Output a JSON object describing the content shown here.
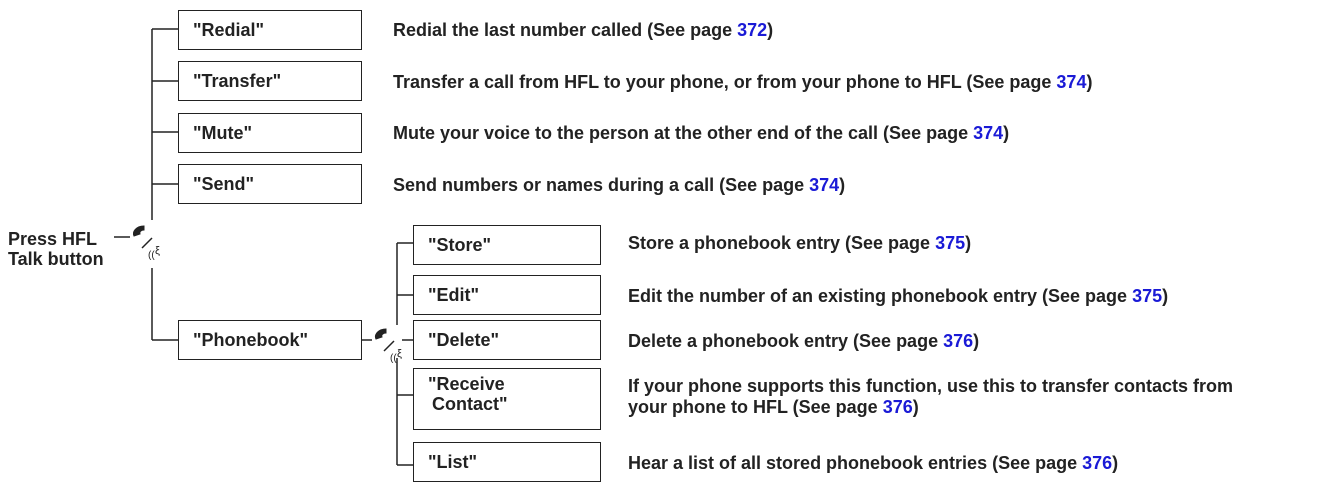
{
  "root": {
    "line1": "Press HFL",
    "line2": "Talk button"
  },
  "top_items": [
    {
      "label": "\"Redial\"",
      "desc": "Redial the last number called (See page ",
      "page": "372",
      "desc_end": ")"
    },
    {
      "label": "\"Transfer\"",
      "desc": "Transfer a call from HFL to your phone, or from your phone to HFL (See page ",
      "page": "374",
      "desc_end": ")"
    },
    {
      "label": "\"Mute\"",
      "desc": "Mute your voice to the person at the other end of the call (See page ",
      "page": "374",
      "desc_end": ")"
    },
    {
      "label": "\"Send\"",
      "desc": "Send numbers or names during a call (See page ",
      "page": "374",
      "desc_end": ")"
    },
    {
      "label": "\"Phonebook\""
    }
  ],
  "phonebook_items": [
    {
      "label": "\"Store\"",
      "desc": "Store a phonebook entry (See page ",
      "page": "375",
      "desc_end": ")"
    },
    {
      "label": "\"Edit\"",
      "desc": "Edit the number of an existing phonebook entry (See page ",
      "page": "375",
      "desc_end": ")"
    },
    {
      "label": "\"Delete\"",
      "desc": "Delete a phonebook entry (See page ",
      "page": "376",
      "desc_end": ")"
    },
    {
      "label_line1": "\"Receive",
      "label_line2": "Contact\"",
      "desc_line1": "If your phone supports this function, use this to transfer contacts from",
      "desc_line2": "your phone to HFL (See page ",
      "page": "376",
      "desc_end": ")"
    },
    {
      "label": "\"List\"",
      "desc": "Hear a list of all stored phonebook entries (See page ",
      "page": "376",
      "desc_end": ")"
    }
  ],
  "icons": {
    "talk": "talk-button-icon"
  },
  "colors": {
    "page_link": "#1a1ad6"
  }
}
